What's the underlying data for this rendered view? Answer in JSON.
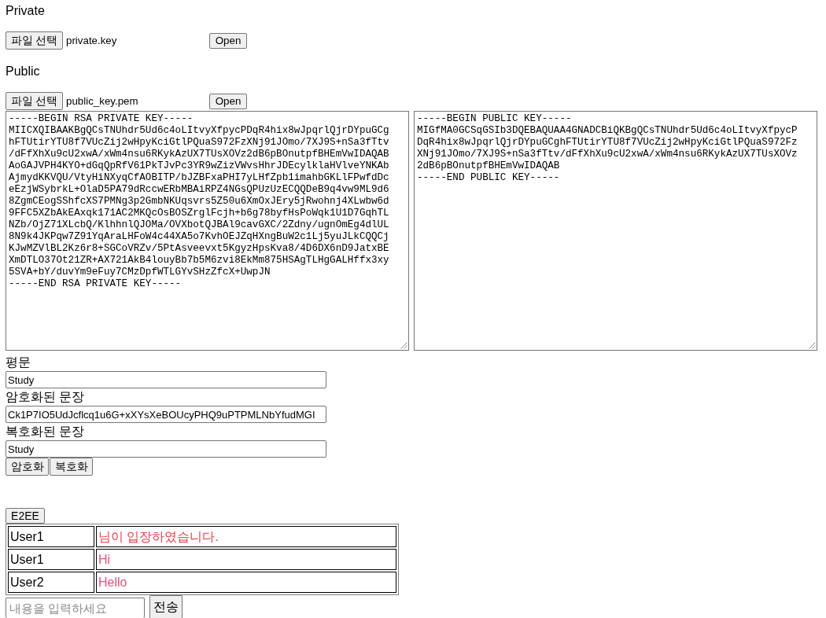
{
  "key_files": [
    {
      "label": "Private",
      "file_button": "파일 선택",
      "file_name": "private.key",
      "open_button": "Open"
    },
    {
      "label": "Public",
      "file_button": "파일 선택",
      "file_name": "public_key.pem",
      "open_button": "Open"
    }
  ],
  "key_text_areas": [
    {
      "text": "-----BEGIN RSA PRIVATE KEY-----\nMIICXQIBAAKBgQCsTNUhdr5Ud6c4oLItvyXfpycPDqR4hix8wJpqrlQjrDYpuGCg\nhFTUtirYTU8f7VUcZij2wHpyKciGtlPQuaS972FzXNj91JOmo/7XJ9S+nSa3fTtv\n/dFfXhXu9cU2xwA/xWm4nsu6RKykAzUX7TUsXOVz2dB6pBOnutpfBHEmVwIDAQAB\nAoGAJVPH4KYO+dGqQpRfV61PkTJvPc3YR9wZizVWvsHhrJDEcylklaHVlveYNKAb\nAjmydKKVQU/VtyHiNXyqCfAOBITP/bJZBFxaPHI7yLHfZpb1imahbGKLlFPwfdDc\neEzjWSybrkL+OlaD5PA79dRccwERbMBAiRPZ4NGsQPUzUzECQQDeB9q4vw9ML9d6\n8ZgmCEogSShfcXS7PMNg3p2GmbNKUqsvrs5Z50u6XmOxJEry5jRwohnj4XLwbw6d\n9FFC5XZbAkEAxqk171AC2MKQcOsBOSZrglFcjh+b6g78byfHsPoWqk1U1D7GqhTL\nNZb/OjZ71XLcbQ/KlhhnlQJOMa/OVXbotQJBAl9cavGXC/2Zdny/ugnOmEg4dlUL\n8N9k4JKPqw7Z91YqAraLHFoW4c44XA5o7KvhOEJZqHXngBuW2c1Lj5yuJLkCQQCj\nKJwMZVlBL2Kz6r8+SGCoVRZv/5PtAsveevxt5KgyzHpsKva8/4D6DX6nD9JatxBE\nXmDTLO37Ot21ZR+AX721AkB4louyBb7b5M6zvi8EkMm875HSAgTLHgGALHffx3xy\n5SVA+bY/duvYm9eFuy7CMzDpfWTLGYvSHzZfcX+UwpJN\n-----END RSA PRIVATE KEY-----"
    },
    {
      "text": "-----BEGIN PUBLIC KEY-----\nMIGfMA0GCSqGSIb3DQEBAQUAA4GNADCBiQKBgQCsTNUhdr5Ud6c4oLItvyXfpycP\nDqR4hix8wJpqrlQjrDYpuGCghFTUtirYTU8f7VUcZij2wHpyKciGtlPQuaS972Fz\nXNj91JOmo/7XJ9S+nSa3fTtv/dFfXhXu9cU2xwA/xWm4nsu6RKykAzUX7TUsXOVz\n2dB6pBOnutpfBHEmVwIDAQAB\n-----END PUBLIC KEY-----"
    }
  ],
  "fields": [
    {
      "label": "평문",
      "value": "Study"
    },
    {
      "label": "암호화된 문장",
      "value": "Ck1P7IO5UdJcflcq1u6G+xXYsXeBOUcyPHQ9uPTPMLNbYfudMGI"
    },
    {
      "label": "복호화된 문장",
      "value": "Study"
    }
  ],
  "action_buttons": [
    "암호화",
    "복호화"
  ],
  "e2ee_button": "E2EE",
  "chat": {
    "rows": [
      {
        "user": "User1",
        "message": "님이 입장하였습니다.",
        "color": "#f5394a"
      },
      {
        "user": "User1",
        "message": "Hi",
        "color": "#ec4f78"
      },
      {
        "user": "User2",
        "message": "Hello",
        "color": "#ec4f78"
      }
    ],
    "input": {
      "placeholder": "내용을 입력하세요"
    },
    "send_button": "전송"
  }
}
